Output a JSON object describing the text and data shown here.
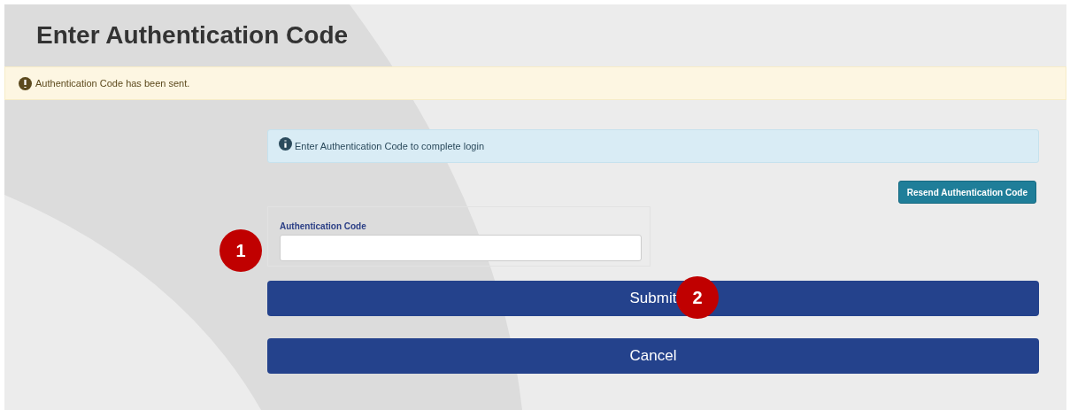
{
  "page": {
    "title": "Enter Authentication Code"
  },
  "alert": {
    "kind": "warning",
    "message": "Authentication Code has been sent."
  },
  "info": {
    "kind": "info",
    "message": "Enter Authentication Code to complete login"
  },
  "resend_button": "Resend Authentication Code",
  "form": {
    "label": "Authentication Code"
  },
  "buttons": [
    "Submit",
    "Cancel"
  ],
  "markers": [
    {
      "label": "1"
    },
    {
      "label": "2"
    }
  ]
}
